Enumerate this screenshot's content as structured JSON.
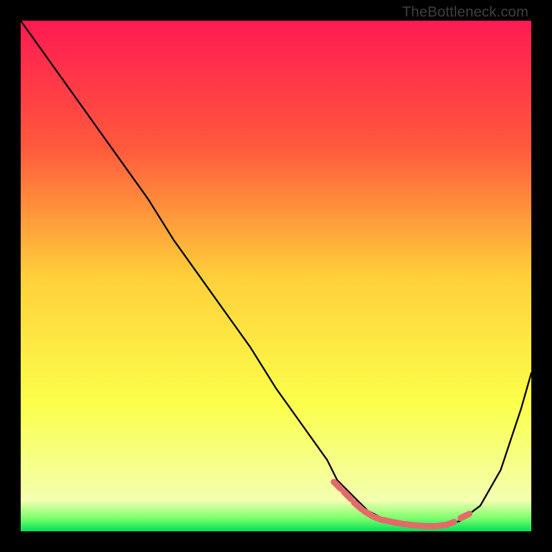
{
  "watermark": "TheBottleneck.com",
  "chart_data": {
    "type": "line",
    "title": "",
    "xlabel": "",
    "ylabel": "",
    "xlim": [
      0,
      100
    ],
    "ylim": [
      0,
      100
    ],
    "gradient_stops": [
      {
        "offset": 0.0,
        "color": "#ff1a52"
      },
      {
        "offset": 0.25,
        "color": "#ff5a3c"
      },
      {
        "offset": 0.5,
        "color": "#ffcf3a"
      },
      {
        "offset": 0.75,
        "color": "#fbff4a"
      },
      {
        "offset": 0.94,
        "color": "#f3ffb0"
      },
      {
        "offset": 0.975,
        "color": "#7aff6a"
      },
      {
        "offset": 1.0,
        "color": "#00e05a"
      }
    ],
    "series": [
      {
        "name": "bottleneck-curve",
        "x": [
          0,
          5,
          10,
          15,
          20,
          25,
          30,
          35,
          40,
          45,
          50,
          55,
          60,
          62,
          65,
          68,
          72,
          75,
          78,
          80,
          83,
          86,
          90,
          94,
          98,
          100
        ],
        "y": [
          100,
          93,
          86,
          79,
          72,
          65,
          57,
          50,
          43,
          36,
          28,
          21,
          14,
          10,
          7,
          4,
          2,
          1.3,
          1.0,
          1.0,
          1.2,
          2.0,
          5.0,
          12,
          24,
          31
        ]
      }
    ],
    "markers": {
      "name": "highlighted-range",
      "color": "#e46a6a",
      "points": [
        {
          "x": 62,
          "y": 9
        },
        {
          "x": 64,
          "y": 7
        },
        {
          "x": 66,
          "y": 5
        },
        {
          "x": 68,
          "y": 3.5
        },
        {
          "x": 70,
          "y": 2.5
        },
        {
          "x": 72,
          "y": 2
        },
        {
          "x": 74,
          "y": 1.6
        },
        {
          "x": 76,
          "y": 1.3
        },
        {
          "x": 78,
          "y": 1.1
        },
        {
          "x": 80,
          "y": 1.0
        },
        {
          "x": 82,
          "y": 1.1
        },
        {
          "x": 84,
          "y": 1.5
        },
        {
          "x": 87,
          "y": 3.0
        }
      ]
    }
  }
}
